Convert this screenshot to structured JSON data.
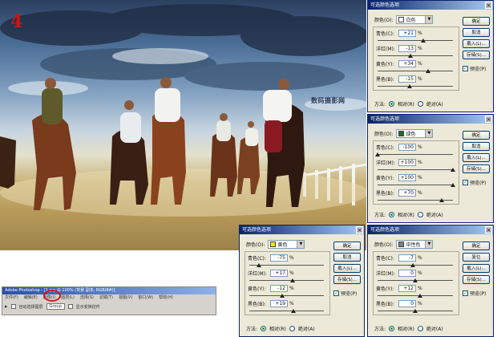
{
  "photo": {
    "step_number": "4",
    "watermark": "数码摄影网"
  },
  "photoshop": {
    "title_bar": "Adobe Photoshop - [1.jpg @ 100% (背景 副本, RGB/8#)]",
    "menu": [
      "文件(F)",
      "编辑(E)",
      "图像(I)",
      "图层(L)",
      "选择(S)",
      "滤镜(T)",
      "视图(V)",
      "窗口(W)",
      "帮助(H)"
    ],
    "option_auto_select": "自动选择图层",
    "option_group": "Group",
    "option_show_transform": "显示变换控件"
  },
  "dialogs": [
    {
      "title": "可选颜色选项",
      "color_label": "颜色(O):",
      "color_value": "白色",
      "swatch_color": "#ffffff",
      "sliders": [
        {
          "label": "青色(C):",
          "value": "+21",
          "pos": 0.605
        },
        {
          "label": "洋红(M):",
          "value": "-13",
          "pos": 0.435
        },
        {
          "label": "黄色(Y):",
          "value": "+34",
          "pos": 0.67
        },
        {
          "label": "黑色(B):",
          "value": "-15",
          "pos": 0.425
        }
      ],
      "pct": "%",
      "buttons": [
        "确定",
        "取消",
        "载入(L)...",
        "存储(S)..."
      ],
      "preview_label": "预览(P)",
      "method_label": "方法:",
      "method_relative": "相对(R)",
      "method_absolute": "绝对(A)"
    },
    {
      "title": "可选颜色选项",
      "color_label": "颜色(O):",
      "color_value": "绿色",
      "swatch_color": "#1f6b1f",
      "sliders": [
        {
          "label": "青色(C):",
          "value": "-100",
          "pos": 0.0
        },
        {
          "label": "洋红(M):",
          "value": "+100",
          "pos": 1.0
        },
        {
          "label": "黄色(Y):",
          "value": "+100",
          "pos": 1.0
        },
        {
          "label": "黑色(B):",
          "value": "+70",
          "pos": 0.85
        }
      ],
      "pct": "%",
      "buttons": [
        "确定",
        "取消",
        "载入(L)...",
        "存储(S)..."
      ],
      "preview_label": "预览(P)",
      "method_label": "方法:",
      "method_relative": "相对(R)",
      "method_absolute": "绝对(A)"
    },
    {
      "title": "可选颜色选项",
      "color_label": "颜色(O):",
      "color_value": "黄色",
      "swatch_color": "#f5e600",
      "sliders": [
        {
          "label": "青色(C):",
          "value": "-75",
          "pos": 0.125
        },
        {
          "label": "洋红(M):",
          "value": "+17",
          "pos": 0.585
        },
        {
          "label": "黄色(Y):",
          "value": "-12",
          "pos": 0.44
        },
        {
          "label": "黑色(B):",
          "value": "+19",
          "pos": 0.595
        }
      ],
      "pct": "%",
      "buttons": [
        "确定",
        "取消",
        "载入(L)...",
        "存储(S)..."
      ],
      "preview_label": "预览(P)",
      "method_label": "方法:",
      "method_relative": "相对(R)",
      "method_absolute": "绝对(A)"
    },
    {
      "title": "可选颜色选项",
      "color_label": "颜色(O):",
      "color_value": "中性色",
      "swatch_color": "#808080",
      "sliders": [
        {
          "label": "青色(C):",
          "value": "-7",
          "pos": 0.465
        },
        {
          "label": "洋红(M):",
          "value": "0",
          "pos": 0.5
        },
        {
          "label": "黄色(Y):",
          "value": "+12",
          "pos": 0.56
        },
        {
          "label": "黑色(B):",
          "value": "0",
          "pos": 0.5
        }
      ],
      "pct": "%",
      "buttons": [
        "确定",
        "复位",
        "载入(L)...",
        "存储(S)..."
      ],
      "preview_label": "预览(P)",
      "method_label": "方法:",
      "method_relative": "相对(R)",
      "method_absolute": "绝对(A)"
    }
  ]
}
